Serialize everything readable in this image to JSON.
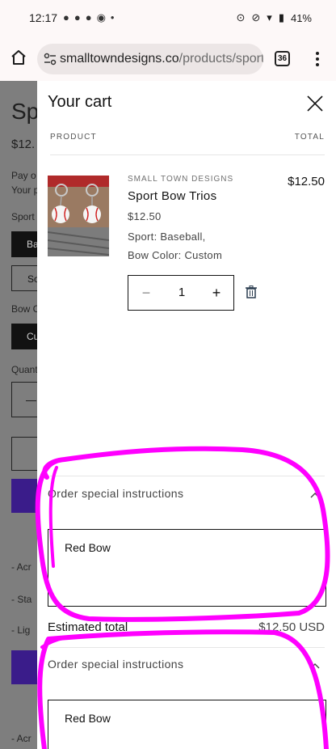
{
  "status_bar": {
    "time": "12:17",
    "notification_icons": [
      "message-icon",
      "message-icon",
      "message-icon",
      "messenger-icon",
      "dot-icon"
    ],
    "right_icons": [
      "alarm-icon",
      "mute-icon",
      "wifi-icon",
      "battery-icon"
    ],
    "battery": "41%"
  },
  "browser": {
    "url_domain": "smalltowndesigns.co",
    "url_path": "/products/sport",
    "tab_count": "36"
  },
  "background_page": {
    "title": "Sp",
    "price": "$12.",
    "lines": [
      "Pay o",
      "Your p",
      "Sport",
      "Bow C",
      "Quant",
      "- Acr",
      "- Sta",
      "- Lig",
      "- Acr"
    ],
    "button_labels": [
      "Ba",
      "So",
      "Cu"
    ],
    "qty_minus": "—"
  },
  "cart": {
    "title": "Your cart",
    "col_product": "PRODUCT",
    "col_total": "TOTAL",
    "item": {
      "vendor": "SMALL TOWN DESIGNS",
      "name": "Sport Bow Trios",
      "price": "$12.50",
      "option_sport": "Sport: Baseball,",
      "option_bow": "Bow Color: Custom",
      "line_total": "$12.50",
      "quantity": "1",
      "minus": "−",
      "plus": "+"
    },
    "instructions_label": "Order special instructions",
    "instructions_value": "Red Bow",
    "estimated_total_label": "Estimated total",
    "estimated_total_value": "$12.50 USD",
    "instructions_label_2": "Order special instructions",
    "instructions_value_2": "Red Bow"
  },
  "colors": {
    "annotation": "#ff00ff",
    "overlay": "#7e7e7e",
    "dark": "#121212",
    "accent_purple": "#3a1c8a"
  }
}
